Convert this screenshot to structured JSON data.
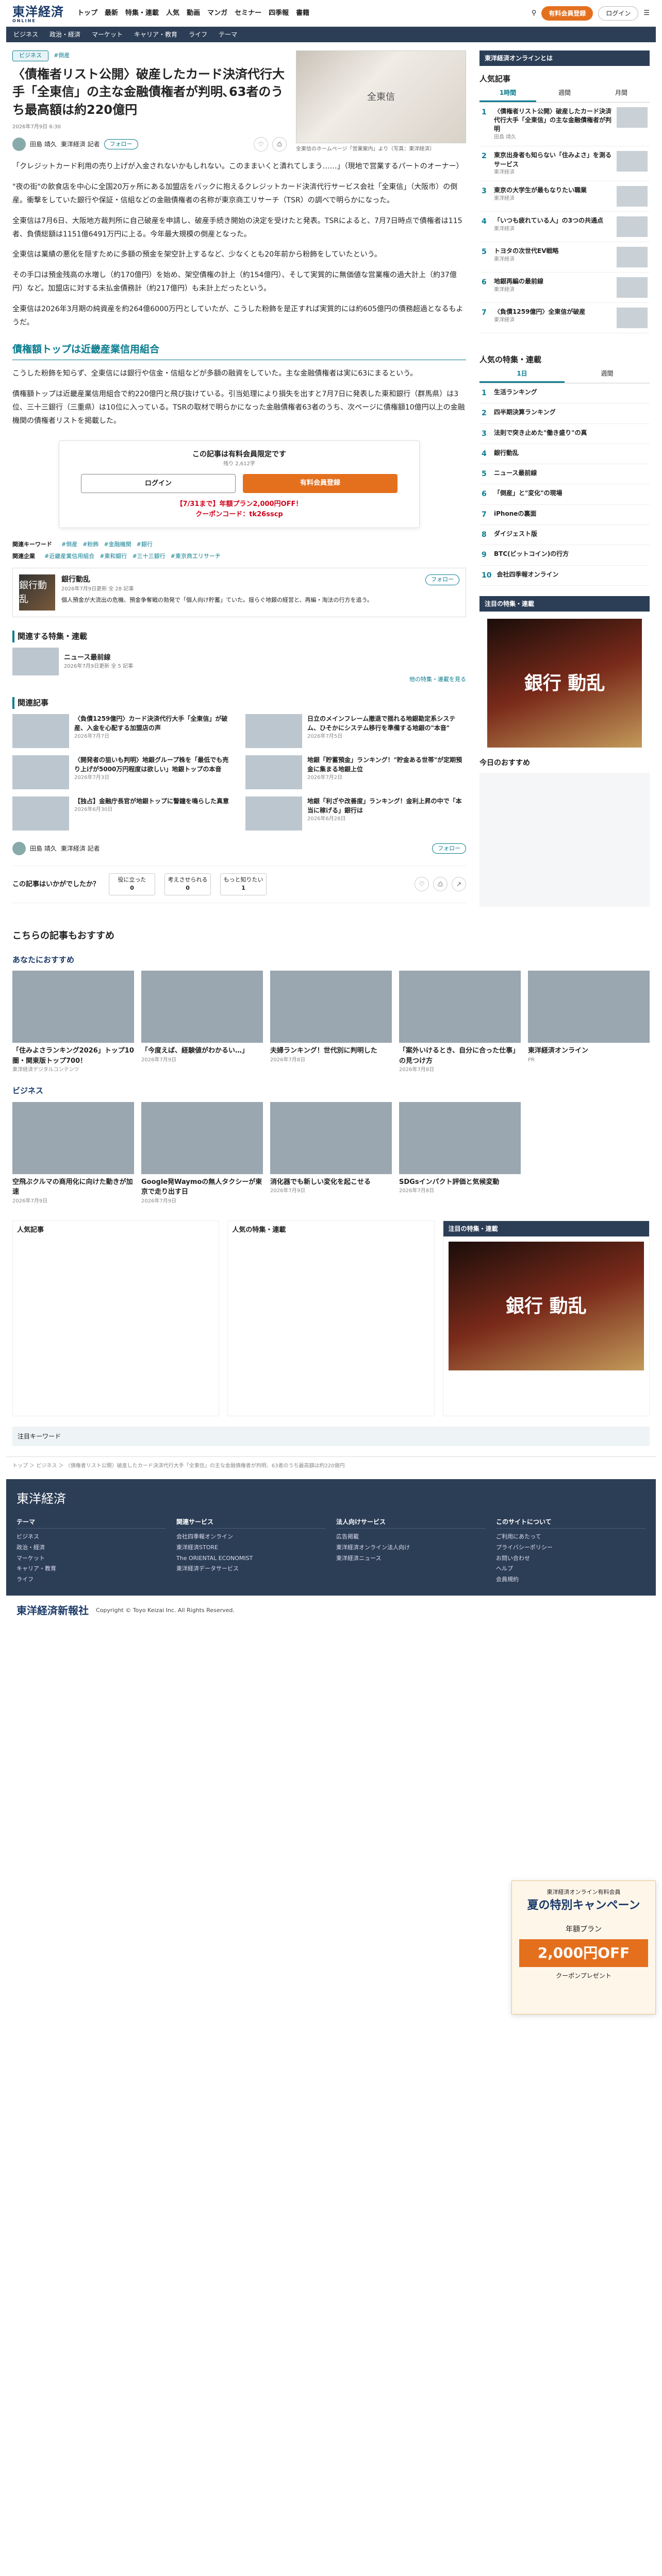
{
  "header": {
    "logo": "東洋経済",
    "logo_sub": "ONLINE",
    "nav": [
      "トップ",
      "最新",
      "特集・連載",
      "人気",
      "動画",
      "マンガ",
      "セミナー",
      "四季報",
      "書籍"
    ],
    "subscribe": "有料会員登録",
    "login": "ログイン"
  },
  "subnav": [
    "ビジネス",
    "政治・経済",
    "マーケット",
    "キャリア・教育",
    "ライフ",
    "テーマ"
  ],
  "article": {
    "tag": "ビジネス",
    "tag_link": "#倒産",
    "title": "〈債権者リスト公開〉破産したカード決済代行大手「全東信」の主な金融債権者が判明､63者のうち最高額は約220億円",
    "meta": "2026年7月9日 6:30",
    "image_label": "全東信",
    "image_caption": "全東信のホームページ「営業案内」より（写真：東洋経済）",
    "author": "田島 靖久",
    "author_role": "東洋経済 記者",
    "follow": "フォロー",
    "paras": [
      "「クレジットカード利用の売り上げが入金されないかもしれない。このままいくと潰れてしまう……」（現地で営業するパートのオーナー）",
      "\"夜の街\"の飲食店を中心に全国20万ヶ所にある加盟店をバックに抱えるクレジットカード決済代行サービス会社「全東信」（大阪市）の倒産。衝撃をしていた銀行や保証・信組などの金融債権者の名称が東京商工リサーチ（TSR）の調べで明らかになった。",
      "全東信は7月6日、大阪地方裁判所に自己破産を申請し、破産手続き開始の決定を受けたと発表。TSRによると、7月7日時点で債権者は115者、負債総額は1151億6491万円に上る。今年最大規模の倒産となった。",
      "全東信は業績の悪化を隠すために多額の預金を架空計上するなど、少なくとも20年前から粉飾をしていたという。",
      "その手口は預金残高の水増し（約170億円）を始め、架空債権の計上（約154億円）、そして実質的に無価値な営業権の過大計上（約37億円）など。加盟店に対する未払金債務計（約217億円）も未計上だったという。",
      "全東信は2026年3月期の純資産を約264億6000万円としていたが、こうした粉飾を是正すれば実質的には約605億円の債務超過となるもようだ。"
    ],
    "section_title": "債権額トップは近畿産業信用組合",
    "paras2": [
      "こうした粉飾を知らず、全東信には銀行や信金・信組などが多額の融資をしていた。主な金融債権者は実に63にまるという。",
      "債権額トップは近畿産業信用組合で約220億円と飛び抜けている。引当処理により損失を出すと7月7日に発表した東和銀行（群馬県）は3位、三十三銀行（三重県）は10位に入っている。TSRの取材で明らかになった金融債権者63者のうち、次ページに債権額10億円以上の金融機関の債権者リストを掲載した。"
    ]
  },
  "paywall": {
    "title": "この記事は有料会員限定です",
    "sub": "残り 2,612字",
    "login": "ログイン",
    "subscribe": "有料会員登録",
    "promo": "【7/31まで】年額プラン2,000円OFF！",
    "coupon": "クーポンコード：tk26sscp"
  },
  "keywords": {
    "label1": "関連キーワード",
    "row1": [
      "#倒産",
      "#粉飾",
      "#金融機関",
      "#銀行"
    ],
    "label2": "関連企業",
    "row2": [
      "#近畿産業信用組合",
      "#東和銀行",
      "#三十三銀行",
      "#東京商工リサーチ"
    ]
  },
  "series": {
    "title": "銀行動乱",
    "date": "2026年7月9日更新",
    "count": "全 28 記事",
    "follow": "フォロー",
    "desc": "個人預金が大流出の危機、預金争奪戦の勃発で「個人向け貯蓄」ていた。揺らぐ地銀の経営と、再編・淘汰の行方を追う。"
  },
  "related_series": {
    "heading": "関連する特集・連載",
    "item": "ニュース最前線",
    "item_meta": "2026年7月9日更新 全 5 記事",
    "more": "他の特集・連載を見る"
  },
  "related": {
    "heading": "関連記事",
    "items": [
      {
        "t": "〈負債1259億円〉カード決済代行大手「全東信」が破産、入金を心配する加盟店の声",
        "s": "2026年7月7日"
      },
      {
        "t": "日立のメインフレーム撤退で揺れる地銀勘定系システム、ひそかにシステム移行を準備する地銀の\"本音\"",
        "s": "2026年7月5日"
      },
      {
        "t": "〈開発者の狙いも判明〉地銀グループ株を「最低でも売り上げが5000万円程度は欲しい」地銀トップの本音",
        "s": "2026年7月3日"
      },
      {
        "t": "地銀「貯蓄預金」ランキング！\"貯金ある世帯\"が定期預金に集まる地銀上位",
        "s": "2026年7月2日"
      },
      {
        "t": "【独占】金融庁長官が地銀トップに警鐘を鳴らした真意",
        "s": "2026年6月30日"
      },
      {
        "t": "地銀「利ざや改善度」ランキング！金利上昇の中で「本当に稼げる」銀行は",
        "s": "2026年6月28日"
      }
    ]
  },
  "reactions": {
    "question": "この記事はいかがでしたか？",
    "buttons": [
      "役に立った",
      "考えさせられる",
      "もっと知りたい"
    ],
    "counts": [
      "0",
      "0",
      "1"
    ]
  },
  "recommend": {
    "title": "こちらの記事もおすすめ",
    "sub1": "あなたにおすすめ",
    "cards": [
      {
        "t": "「住みよさランキング2026」トップ10圏・関東版トップ700！",
        "a": "東洋経済デジタルコンテンツ"
      },
      {
        "t": "「今度えば、経験値がわかるい…」",
        "a": "2026年7月9日"
      },
      {
        "t": "夫婦ランキング！世代別に判明した",
        "a": "2026年7月8日"
      },
      {
        "t": "「案外いけるとき、自分に合った仕事」の見つけ方",
        "a": "2026年7月8日"
      },
      {
        "t": "東洋経済オンライン",
        "a": "PR"
      }
    ],
    "sub2": "ビジネス",
    "cards2": [
      {
        "t": "空飛ぶクルマの商用化に向けた動きが加速",
        "a": "2026年7月9日"
      },
      {
        "t": "Google発Waymoの無人タクシーが東京で走り出す日",
        "a": "2026年7月9日"
      },
      {
        "t": "消化器でも新しい変化を起こせる",
        "a": "2026年7月9日"
      },
      {
        "t": "SDGsインパクト評価と気候変動",
        "a": "2026年7月8日"
      }
    ]
  },
  "promo": {
    "title": "東洋経済オンライン有料会員",
    "headline": "夏の特別キャンペーン",
    "plan": "年額プラン",
    "amount": "2,000円OFF",
    "note": "クーポンプレゼント"
  },
  "sidebar": {
    "head1": "東洋経済オンラインとは",
    "ranking_title": "人気記事",
    "tabs": [
      "1時間",
      "週間",
      "月間"
    ],
    "ranking": [
      {
        "t": "〈債権者リスト公開〉破産したカード決済代行大手「全東信」の主な金融債権者が判明",
        "w": "田島 靖久"
      },
      {
        "t": "東京出身者も知らない「住みよさ」を測るサービス",
        "w": "東洋経済"
      },
      {
        "t": "東京の大学生が最もなりたい職業",
        "w": "東洋経済"
      },
      {
        "t": "「いつも疲れている人」の3つの共通点",
        "w": "東洋経済"
      },
      {
        "t": "トヨタの次世代EV戦略",
        "w": "東洋経済"
      },
      {
        "t": "地銀再編の最前線",
        "w": "東洋経済"
      },
      {
        "t": "〈負債1259億円〉全東信が破産",
        "w": "東洋経済"
      }
    ],
    "series_title": "人気の特集・連載",
    "series_tabs": [
      "1日",
      "週間"
    ],
    "series": [
      "生活ランキング",
      "四半期決算ランキング",
      "法則で突き止めた\"働き盛り\"の真",
      "銀行動乱",
      "ニュース最前線",
      "「倒産」と\"変化\"の現場",
      "iPhoneの裏面",
      "ダイジェスト版",
      "BTC(ビットコイン)の行方",
      "会社四季報オンライン"
    ],
    "ad_label": "銀行 動乱",
    "ad_title": "注目の特集・連載",
    "today_title": "今日のおすすめ"
  },
  "bottom": {
    "col1": "人気記事",
    "col2": "人気の特集・連載",
    "col3": "注目の特集・連載"
  },
  "kwbar": "注目キーワード",
  "breadcrumb": "トップ ＞ ビジネス ＞ 〈債権者リスト公開〉破産したカード決済代行大手「全東信」の主な金融債権者が判明、63者のうち最高額は約220億円",
  "footer": {
    "logo": "東洋経済",
    "cols": [
      {
        "h": "テーマ",
        "items": [
          "ビジネス",
          "政治・経済",
          "マーケット",
          "キャリア・教育",
          "ライフ"
        ]
      },
      {
        "h": "関連サービス",
        "items": [
          "会社四季報オンライン",
          "東洋経済STORE",
          "The ORIENTAL ECONOMIST",
          "東洋経済データサービス"
        ]
      },
      {
        "h": "法人向けサービス",
        "items": [
          "広告掲載",
          "東洋経済オンライン法人向け",
          "東洋経済ニュース"
        ]
      },
      {
        "h": "このサイトについて",
        "items": [
          "ご利用にあたって",
          "プライバシーポリシー",
          "お問い合わせ",
          "ヘルプ",
          "会員規約"
        ]
      }
    ],
    "company": "東洋経済新報社",
    "copyright": "Copyright © Toyo Keizai Inc. All Rights Reserved."
  }
}
